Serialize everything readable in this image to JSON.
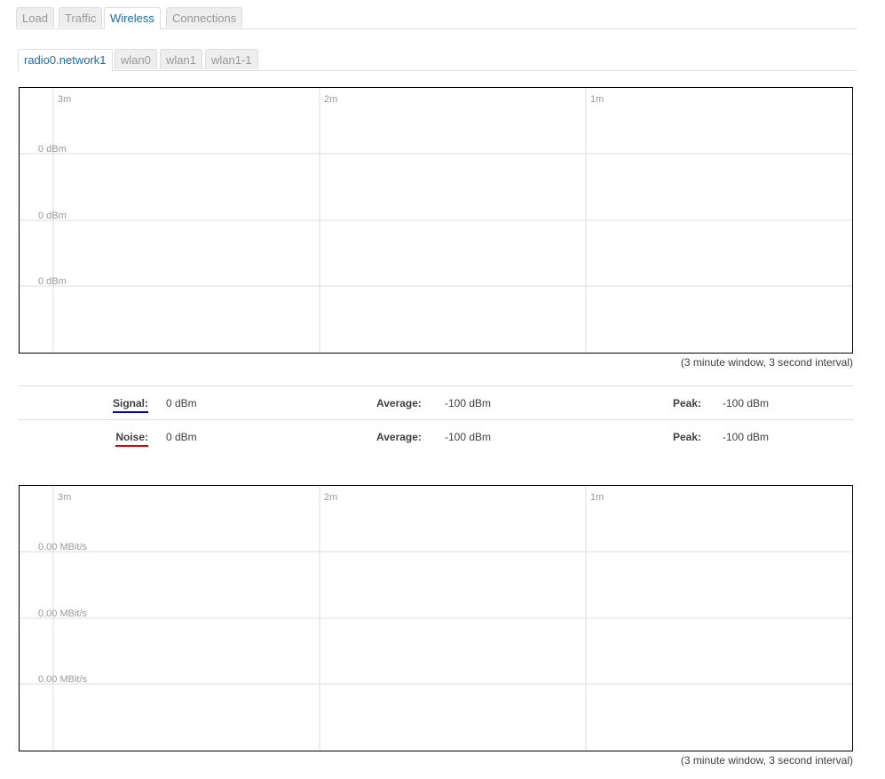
{
  "tabs_primary": [
    "Load",
    "Traffic",
    "Wireless",
    "Connections"
  ],
  "tabs_primary_active": "Wireless",
  "tabs_secondary": [
    "radio0.network1",
    "wlan0",
    "wlan1",
    "wlan1-1"
  ],
  "tabs_secondary_active": "radio0.network1",
  "signal_graph": {
    "time_labels": [
      "3m",
      "2m",
      "1m"
    ],
    "y_labels": [
      "0 dBm",
      "0 dBm",
      "0 dBm"
    ],
    "note": "(3 minute window, 3 second interval)"
  },
  "stats": {
    "signal": {
      "label": "Signal:",
      "value": "0 dBm",
      "avg_label": "Average:",
      "avg": "-100 dBm",
      "peak_label": "Peak:",
      "peak": "-100 dBm",
      "color": "#0000cc"
    },
    "noise": {
      "label": "Noise:",
      "value": "0 dBm",
      "avg_label": "Average:",
      "avg": "-100 dBm",
      "peak_label": "Peak:",
      "peak": "-100 dBm",
      "color": "#dd0000"
    }
  },
  "rate_graph": {
    "time_labels": [
      "3m",
      "2m",
      "1m"
    ],
    "y_labels": [
      "0.00 MBit/s",
      "0.00 MBit/s",
      "0.00 MBit/s"
    ],
    "note": "(3 minute window, 3 second interval)"
  },
  "colors": {
    "active_tab": "#1a6bb5",
    "grid": "#dddddd",
    "label_shadow": "#ffffff"
  }
}
